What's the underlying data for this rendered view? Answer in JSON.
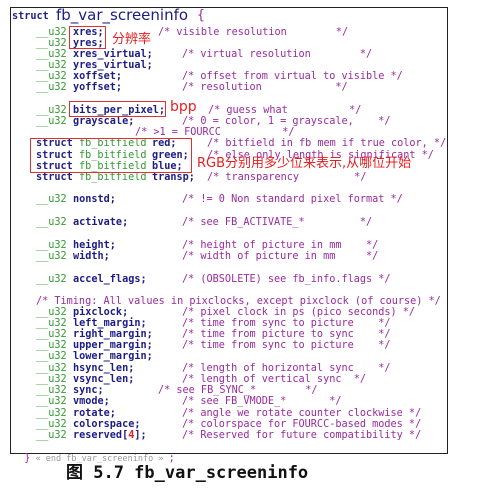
{
  "struct_keyword": "struct",
  "struct_name": "fb_var_screeninfo",
  "open_brace": "{",
  "lines": [
    {
      "type": "__u32",
      "name": "xres;",
      "comment": "/* visible resolution        */"
    },
    {
      "type": "__u32",
      "name": "yres;",
      "comment": ""
    },
    {
      "type": "__u32",
      "name": "xres_virtual;",
      "comment": "/* virtual resolution        */"
    },
    {
      "type": "__u32",
      "name": "yres_virtual;",
      "comment": ""
    },
    {
      "type": "__u32",
      "name": "xoffset;",
      "comment": "/* offset from virtual to visible */"
    },
    {
      "type": "__u32",
      "name": "yoffset;",
      "comment": "/* resolution            */"
    },
    {
      "type": "__u32",
      "name": "bits_per_pixel;",
      "comment": "/* guess what          */"
    },
    {
      "type": "__u32",
      "name": "grayscale;",
      "comment": "/* 0 = color, 1 = grayscale,    */"
    },
    {
      "type": "",
      "name": "",
      "comment": "/* >1 = FOURCC          */"
    },
    {
      "type": "fb_bitfield",
      "name": "red;",
      "comment": "/* bitfield in fb mem if true color, */"
    },
    {
      "type": "fb_bitfield",
      "name": "green;",
      "comment": "/* else only length is significant */"
    },
    {
      "type": "fb_bitfield",
      "name": "blue;",
      "comment": ""
    },
    {
      "type": "fb_bitfield",
      "name": "transp;",
      "comment": "/* transparency         */"
    },
    {
      "type": "__u32",
      "name": "nonstd;",
      "comment": "/* != 0 Non standard pixel format */"
    },
    {
      "type": "__u32",
      "name": "activate;",
      "comment": "/* see FB_ACTIVATE_*         */"
    },
    {
      "type": "__u32",
      "name": "height;",
      "comment": "/* height of picture in mm    */"
    },
    {
      "type": "__u32",
      "name": "width;",
      "comment": "/* width of picture in mm     */"
    },
    {
      "type": "__u32",
      "name": "accel_flags;",
      "comment": "/* (OBSOLETE) see fb_info.flags */"
    },
    {
      "type": "",
      "name": "",
      "comment": "/* Timing: All values in pixclocks, except pixclock (of course) */"
    },
    {
      "type": "__u32",
      "name": "pixclock;",
      "comment": "/* pixel clock in ps (pico seconds) */"
    },
    {
      "type": "__u32",
      "name": "left_margin;",
      "comment": "/* time from sync to picture    */"
    },
    {
      "type": "__u32",
      "name": "right_margin;",
      "comment": "/* time from picture to sync    */"
    },
    {
      "type": "__u32",
      "name": "upper_margin;",
      "comment": "/* time from sync to picture    */"
    },
    {
      "type": "__u32",
      "name": "lower_margin;",
      "comment": ""
    },
    {
      "type": "__u32",
      "name": "hsync_len;",
      "comment": "/* length of horizontal sync    */"
    },
    {
      "type": "__u32",
      "name": "vsync_len;",
      "comment": "/* length of vertical sync  */"
    },
    {
      "type": "__u32",
      "name": "sync;",
      "comment": "/* see FB_SYNC_*        */"
    },
    {
      "type": "__u32",
      "name": "vmode;",
      "comment": "/* see FB_VMODE_*       */"
    },
    {
      "type": "__u32",
      "name": "rotate;",
      "comment": "/* angle we rotate counter clockwise */"
    },
    {
      "type": "__u32",
      "name": "colorspace;",
      "comment": "/* colorspace for FOURCC-based modes */"
    },
    {
      "type": "__u32",
      "name": "reserved[",
      "index": "4",
      "name_end": "];",
      "comment": "/* Reserved for future compatibility */"
    }
  ],
  "struct_kw_inline": "struct",
  "end_line": {
    "brace": "}",
    "text": " « end fb_var_screeninfo » ",
    "semi": ";"
  },
  "annotations": {
    "resolution": "分辨率",
    "bpp": "bpp",
    "rgb": "RGB分别用多少位来表示,从哪位开始"
  },
  "caption": "图 5.7 fb_var_screeninfo"
}
